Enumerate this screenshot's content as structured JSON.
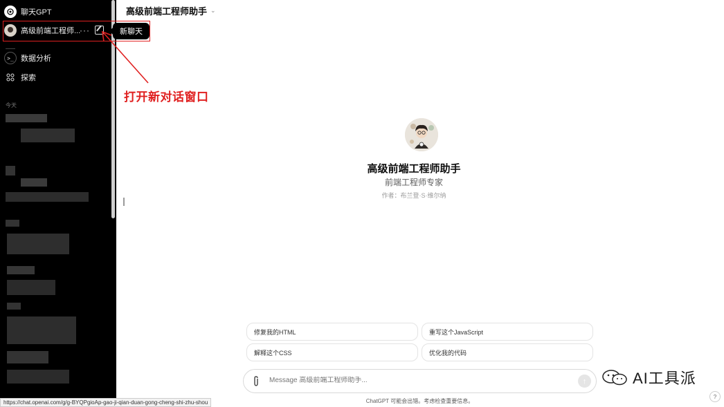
{
  "sidebar": {
    "app_label": "聊天GPT",
    "active_chat": "高级前端工程师...",
    "more_label": "···",
    "items": [
      {
        "label": "数据分析",
        "icon": "terminal-icon"
      },
      {
        "label": "探索",
        "icon": "grid-icon"
      }
    ],
    "section_label": "今天"
  },
  "tooltip": {
    "label": "新聊天"
  },
  "annotation": {
    "label": "打开新对话窗口",
    "color": "#e02020"
  },
  "header": {
    "title": "高级前端工程师助手",
    "chevron": "⌄"
  },
  "profile": {
    "title": "高级前端工程师助手",
    "subtitle": "前端工程师专家",
    "author": "作者：布兰登·S·维尔纳"
  },
  "suggestions": [
    "修复我的HTML",
    "重写这个JavaScript",
    "解释这个CSS",
    "优化我的代码"
  ],
  "composer": {
    "placeholder": "Message 高级前端工程师助手...",
    "send_icon": "arrow-up-icon"
  },
  "footer": {
    "note": "ChatGPT 可能会出错。考虑检查重要信息。",
    "help": "?"
  },
  "status_url": "https://chat.openai.com/g/g-BYQPgioAp-gao-ji-qian-duan-gong-cheng-shi-zhu-shou",
  "watermark": {
    "text": "AI工具派"
  }
}
